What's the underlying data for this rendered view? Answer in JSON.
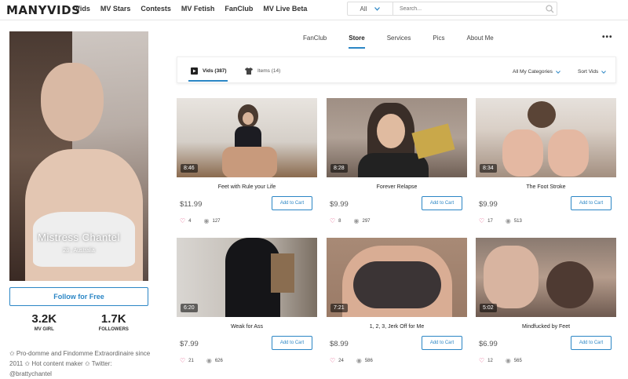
{
  "header": {
    "logo": "MANYVIDS",
    "nav": [
      "Vids",
      "MV Stars",
      "Contests",
      "MV Fetish",
      "FanClub",
      "MV Live Beta"
    ],
    "search": {
      "category": "All",
      "placeholder": "Search..."
    }
  },
  "profile": {
    "name": "Mistress Chantel",
    "location": "28 , Australia",
    "follow_label": "Follow for Free",
    "stats": [
      {
        "value": "3.2K",
        "label": "MV GIRL"
      },
      {
        "value": "1.7K",
        "label": "FOLLOWERS"
      }
    ],
    "bio": "✩ Pro-domme and Findomme Extraordinaire since 2011 ✩ Hot content maker ✩ Twitter: @brattychantel"
  },
  "tabs": [
    "FanClub",
    "Store",
    "Services",
    "Pics",
    "About Me"
  ],
  "active_tab": "Store",
  "subtabs": {
    "vids": "Vids (387)",
    "items": "Items (14)",
    "categories": "All My Categories",
    "sort": "Sort Vids"
  },
  "cart_label": "Add to Cart",
  "videos": [
    {
      "title": "Feet with Rule your Life",
      "duration": "8:46",
      "price": "$11.99",
      "likes": "4",
      "views": "127"
    },
    {
      "title": "Forever Relapse",
      "duration": "8:28",
      "price": "$9.99",
      "likes": "8",
      "views": "297"
    },
    {
      "title": "The Foot Stroke",
      "duration": "8:34",
      "price": "$9.99",
      "likes": "17",
      "views": "513"
    },
    {
      "title": "Weak for Ass",
      "duration": "6:20",
      "price": "$7.99",
      "likes": "21",
      "views": "626"
    },
    {
      "title": "1, 2, 3, Jerk Off for Me",
      "duration": "7:21",
      "price": "$8.99",
      "likes": "24",
      "views": "586"
    },
    {
      "title": "Mindfucked by Feet",
      "duration": "5:02",
      "price": "$6.99",
      "likes": "12",
      "views": "565"
    }
  ],
  "colors": {
    "accent": "#2b86c5",
    "heart": "#e0457b"
  }
}
